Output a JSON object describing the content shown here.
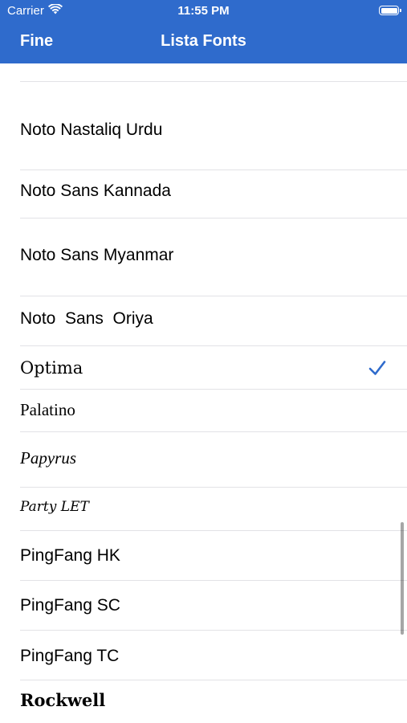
{
  "status_bar": {
    "carrier": "Carrier",
    "time": "11:55 PM"
  },
  "nav": {
    "back_label": "Fine",
    "title": "Lista Fonts"
  },
  "fonts": [
    {
      "label": "Noto Nastaliq Urdu"
    },
    {
      "label": "Noto Sans Kannada"
    },
    {
      "label": "Noto Sans Myanmar"
    },
    {
      "label": "Noto  Sans  Oriya"
    },
    {
      "label": "Optima",
      "selected": true
    },
    {
      "label": "Palatino"
    },
    {
      "label": "Papyrus"
    },
    {
      "label": "Party LET"
    },
    {
      "label": "PingFang HK"
    },
    {
      "label": "PingFang SC"
    },
    {
      "label": "PingFang TC"
    },
    {
      "label": "Rockwell"
    }
  ],
  "colors": {
    "accent": "#2f6bcc",
    "checkmark": "#2f6bcc",
    "separator": "#e2e2e6"
  },
  "icons": {
    "wifi": "wifi-icon",
    "battery": "battery-icon",
    "selected": "checkmark-icon"
  }
}
